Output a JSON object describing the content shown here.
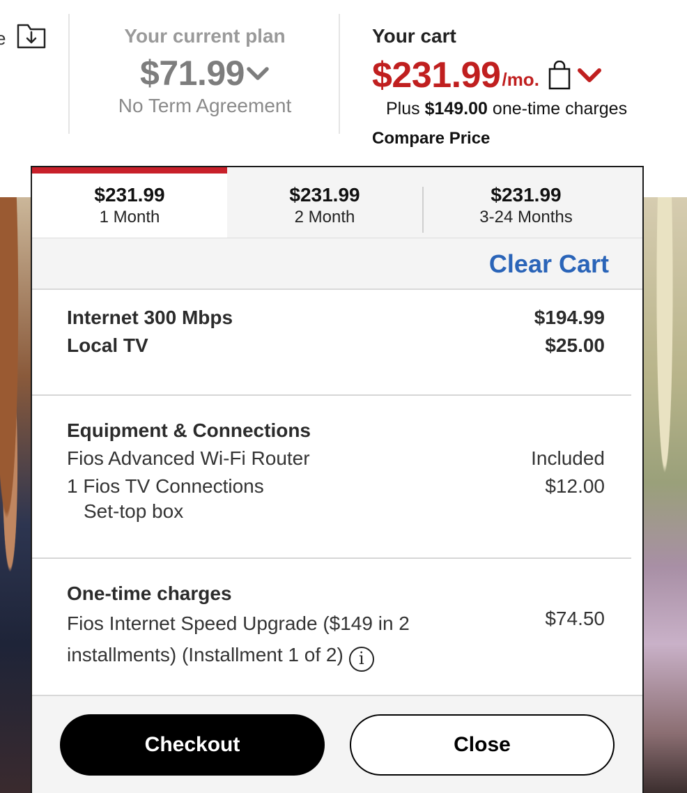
{
  "header": {
    "left_edge_text": "e",
    "current_plan": {
      "label": "Your current plan",
      "price": "$71.99",
      "term": "No Term Agreement"
    },
    "cart": {
      "label": "Your cart",
      "price": "$231.99",
      "per_month": "/mo.",
      "onetime_prefix": "Plus ",
      "onetime_amount": "$149.00",
      "onetime_suffix": " one-time charges",
      "compare_price": "Compare Price"
    }
  },
  "tabs": [
    {
      "amount": "$231.99",
      "period": "1 Month",
      "active": true
    },
    {
      "amount": "$231.99",
      "period": "2 Month",
      "active": false
    },
    {
      "amount": "$231.99",
      "period": "3-24 Months",
      "active": false
    }
  ],
  "clear_cart": "Clear Cart",
  "services": [
    {
      "name": "Internet 300 Mbps",
      "price": "$194.99"
    },
    {
      "name": "Local TV",
      "price": "$25.00"
    }
  ],
  "equipment": {
    "title": "Equipment & Connections",
    "items": [
      {
        "name": "Fios Advanced Wi-Fi Router",
        "price": "Included"
      },
      {
        "name": "1 Fios TV Connections",
        "price": "$12.00"
      }
    ],
    "sub_item": "Set-top box"
  },
  "onetime": {
    "title": "One-time charges",
    "item_name": "Fios Internet Speed Upgrade ($149 in 2 installments) (Installment 1 of 2)",
    "item_price": "$74.50",
    "info_glyph": "i"
  },
  "buttons": {
    "checkout": "Checkout",
    "close": "Close"
  },
  "colors": {
    "accent_red": "#c01f1f",
    "link_blue": "#2a64b8"
  },
  "icons": [
    "download-icon",
    "chevron-down-icon",
    "shopping-bag-icon",
    "info-icon"
  ]
}
